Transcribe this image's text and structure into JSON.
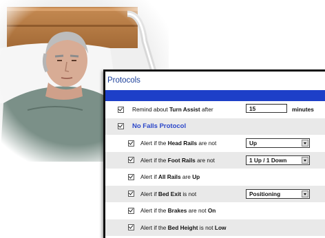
{
  "panel": {
    "title": "Protocols",
    "turn_assist": {
      "pre": "Remind about ",
      "bold": "Turn Assist",
      "post": " after",
      "value": "15",
      "unit": "minutes",
      "checked": true
    },
    "no_falls": {
      "label": "No Falls Protocol",
      "checked": true
    },
    "alerts": [
      {
        "pre": "Alert if the ",
        "bold": "Head Rails",
        "post": " are not",
        "select": "Up"
      },
      {
        "pre": "Alert if the ",
        "bold": "Foot Rails",
        "post": " are not",
        "select": "1 Up / 1 Down"
      },
      {
        "pre": "Alert if ",
        "bold": "All Rails",
        "post": " are ",
        "bold2": "Up"
      },
      {
        "pre": "Alert if ",
        "bold": "Bed Exit",
        "post": " is not",
        "select": "Positioning"
      },
      {
        "pre": "Alert if the ",
        "bold": "Brakes",
        "post": " are not ",
        "bold2": "On"
      },
      {
        "pre": "Alert if the ",
        "bold": "Bed Height",
        "post": " is not ",
        "bold2": "Low"
      }
    ]
  },
  "photo": {
    "subject": "patient-in-hospital-bed"
  }
}
